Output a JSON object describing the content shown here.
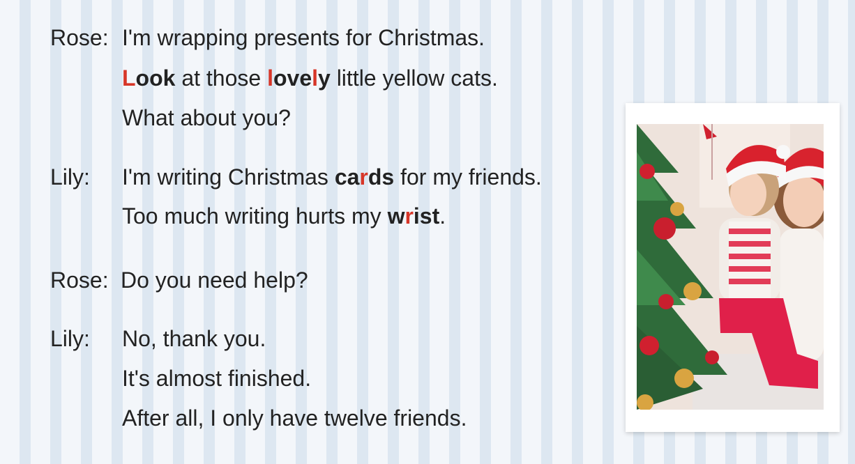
{
  "dialogue": [
    {
      "speaker": "Rose:",
      "lines": [
        [
          {
            "t": "I'm wrapping presents for Christmas."
          }
        ],
        [
          {
            "t": "L",
            "s": "red-bold"
          },
          {
            "t": "ook",
            "s": "bold"
          },
          {
            "t": " at those "
          },
          {
            "t": "l",
            "s": "red-bold"
          },
          {
            "t": "ove",
            "s": "bold"
          },
          {
            "t": "l",
            "s": "red-bold"
          },
          {
            "t": "y",
            "s": "bold"
          },
          {
            "t": " little yellow cats."
          }
        ],
        [
          {
            "t": "What about you?"
          }
        ]
      ]
    },
    {
      "speaker": "Lily:",
      "lines": [
        [
          {
            "t": "I'm writing Christmas "
          },
          {
            "t": "ca",
            "s": "bold"
          },
          {
            "t": "r",
            "s": "red-bold"
          },
          {
            "t": "ds",
            "s": "bold"
          },
          {
            "t": " for my friends."
          }
        ],
        [
          {
            "t": "Too much writing hurts my "
          },
          {
            "t": "w",
            "s": "bold"
          },
          {
            "t": "r",
            "s": "red-bold"
          },
          {
            "t": "ist",
            "s": "bold"
          },
          {
            "t": "."
          }
        ]
      ]
    },
    {
      "speaker": "Rose:",
      "lines": [
        [
          {
            "t": "Do you need help?"
          }
        ]
      ]
    },
    {
      "speaker": "Lily:",
      "lines": [
        [
          {
            "t": "No, thank you."
          }
        ],
        [
          {
            "t": "It's almost finished."
          }
        ],
        [
          {
            "t": "After all, I only have twelve friends."
          }
        ]
      ]
    }
  ],
  "colors": {
    "text": "#222222",
    "highlight": "#d73628",
    "stripe_light": "#f3f6fa",
    "stripe_dark": "#dde7f1"
  },
  "photo": {
    "icon": "christmas-photo"
  }
}
